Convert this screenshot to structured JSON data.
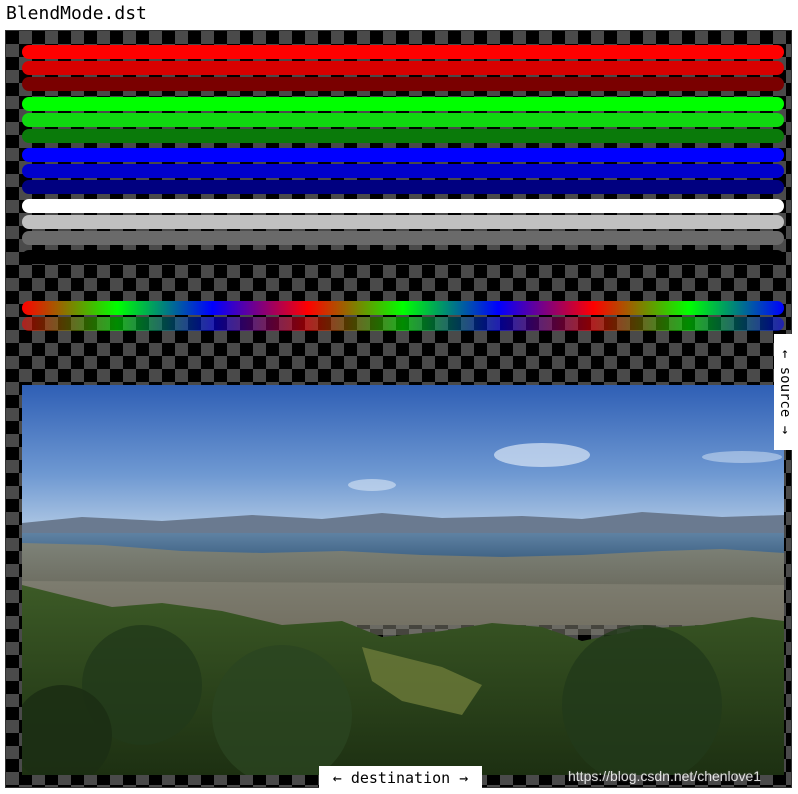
{
  "window": {
    "title": "BlendMode.dst"
  },
  "labels": {
    "source": "← source →",
    "destination": "← destination →"
  },
  "watermark": "https://blog.csdn.net/chenlove1",
  "swatch_groups": [
    {
      "name": "red",
      "colors": [
        "#ff0000",
        "#d80000",
        "#7a0000"
      ]
    },
    {
      "name": "green",
      "colors": [
        "#00ff00",
        "#10d810",
        "#0a7a0a"
      ]
    },
    {
      "name": "blue",
      "colors": [
        "#0000ff",
        "#0000cc",
        "#000080"
      ]
    },
    {
      "name": "gray",
      "colors": [
        "#ffffff",
        "#c0c0c0",
        "#6a6a6a"
      ]
    },
    {
      "name": "black",
      "colors": [
        "#000000"
      ]
    }
  ],
  "spectrum": {
    "colors": [
      "#ff0000",
      "#00ff00",
      "#0000ff",
      "#ff0000",
      "#00ff00",
      "#0000ff",
      "#ff0000",
      "#00ff00",
      "#0000ff"
    ]
  },
  "photo": {
    "subject": "panoramic city view",
    "palette": {
      "sky_top": "#2f5fb5",
      "sky_bottom": "#b6cde6",
      "hills": "#6a7a90",
      "bay": "#4a6d8c",
      "city": "#8a8d86",
      "vegetation": "#2d4a1c"
    }
  }
}
